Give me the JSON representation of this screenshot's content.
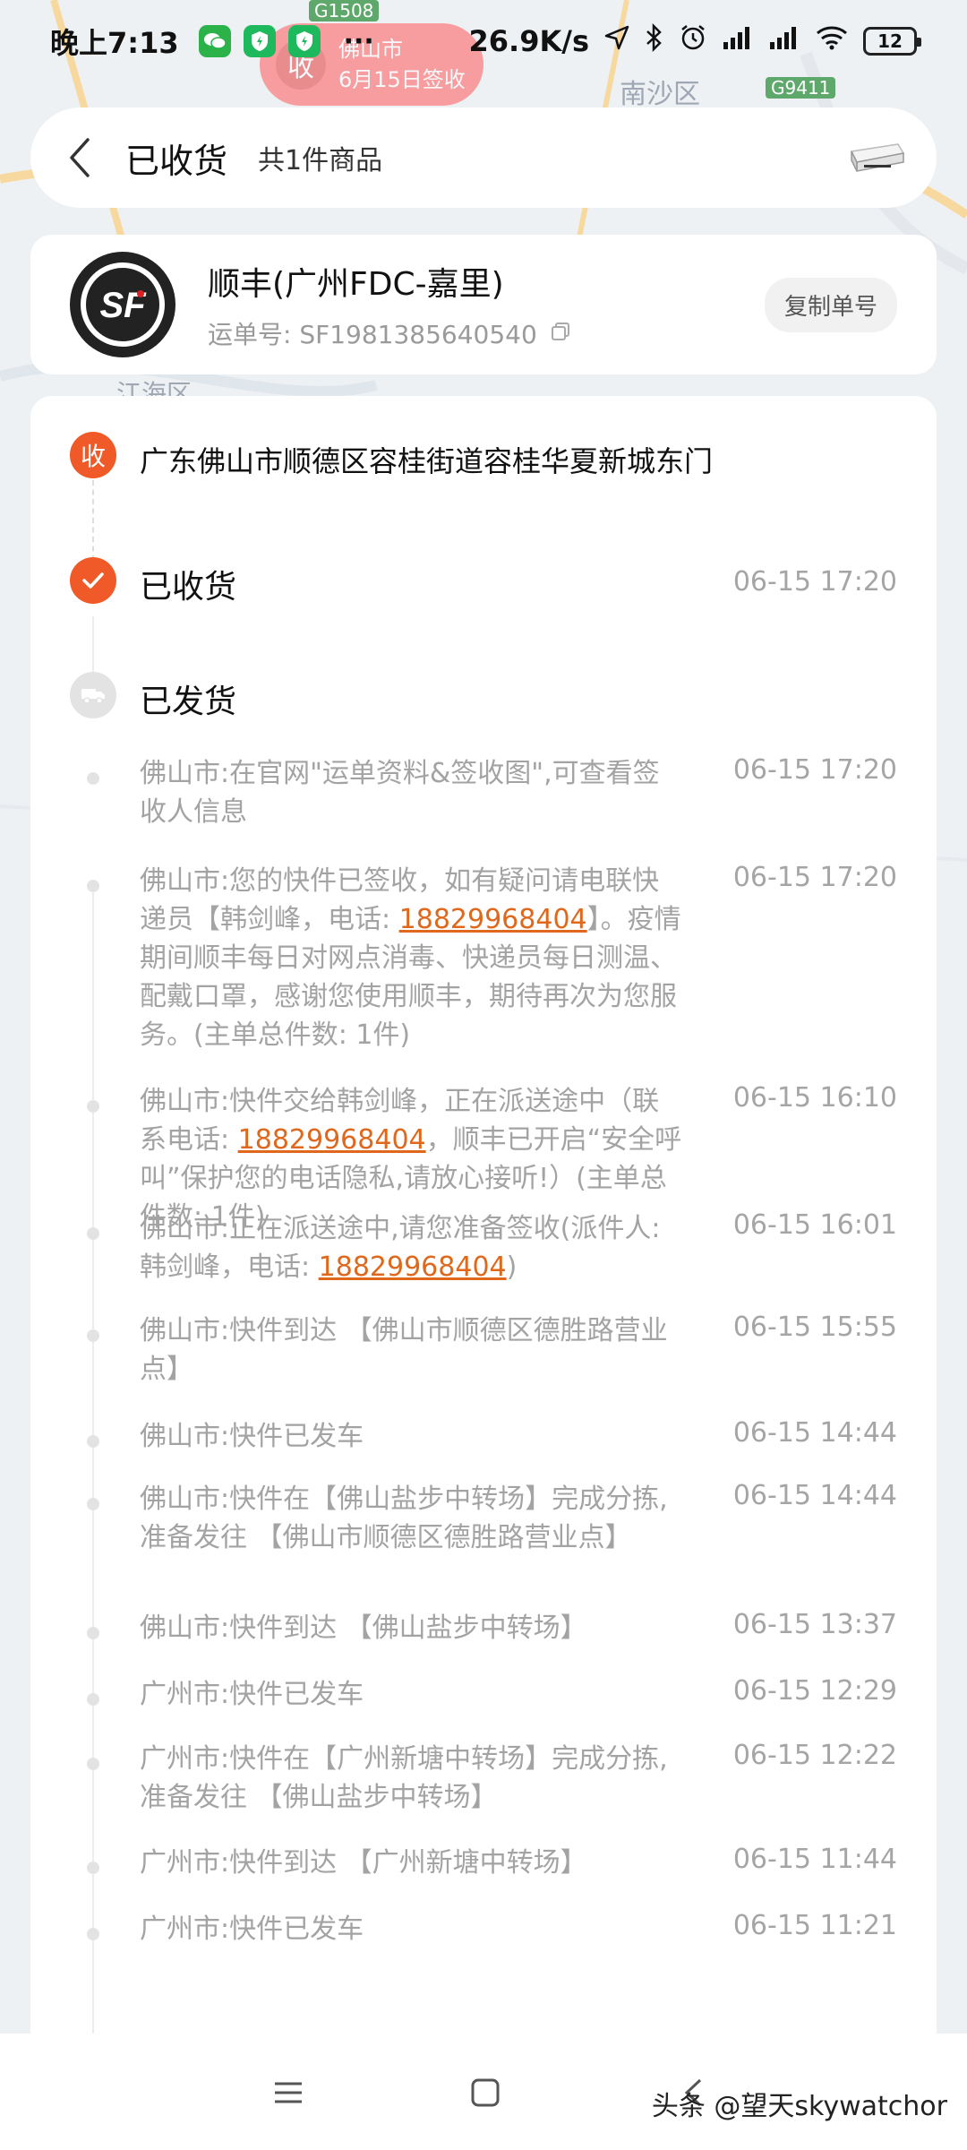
{
  "status_bar": {
    "time": "晚上7:13",
    "dots": "···",
    "speed": "26.9K/s",
    "battery": "12"
  },
  "map": {
    "marker_icon_text": "收",
    "marker_city": "佛山市",
    "marker_date": "6月15日签收",
    "labels": [
      "G1508",
      "南沙区",
      "G9411",
      "江海区"
    ]
  },
  "header": {
    "title": "已收货",
    "item_count": "共1件商品"
  },
  "courier": {
    "name": "顺丰(广州FDC-嘉里)",
    "waybill": "运单号: SF1981385640540",
    "copy_label": "复制单号"
  },
  "timeline": {
    "receiver_icon": "收",
    "address": "广东佛山市顺德区容桂街道容桂华夏新城东门",
    "received_status": "已收货",
    "received_time": "06-15 17:20",
    "shipped_status": "已发货",
    "events": [
      {
        "text_parts": [
          {
            "t": "佛山市:在官网\"运单资料&签收图\",可查看签收人信息"
          }
        ],
        "time": "06-15 17:20"
      },
      {
        "text_parts": [
          {
            "t": "佛山市:您的快件已签收，如有疑问请电联快递员【韩剑峰，电话: "
          },
          {
            "t": "18829968404",
            "link": true
          },
          {
            "t": "】。疫情期间顺丰每日对网点消毒、快递员每日测温、配戴口罩，感谢您使用顺丰，期待再次为您服务。(主单总件数: 1件)"
          }
        ],
        "time": "06-15 17:20"
      },
      {
        "text_parts": [
          {
            "t": "佛山市:快件交给韩剑峰，正在派送途中（联系电话: "
          },
          {
            "t": "18829968404",
            "link": true
          },
          {
            "t": "，顺丰已开启“安全呼叫”保护您的电话隐私,请放心接听!）(主单总件数: 1件)"
          }
        ],
        "time": "06-15 16:10"
      },
      {
        "text_parts": [
          {
            "t": "佛山市:正在派送途中,请您准备签收(派件人: 韩剑峰，电话: "
          },
          {
            "t": "18829968404",
            "link": true
          },
          {
            "t": ")"
          }
        ],
        "time": "06-15 16:01"
      },
      {
        "text_parts": [
          {
            "t": "佛山市:快件到达 【佛山市顺德区德胜路营业点】"
          }
        ],
        "time": "06-15 15:55"
      },
      {
        "text_parts": [
          {
            "t": "佛山市:快件已发车"
          }
        ],
        "time": "06-15 14:44"
      },
      {
        "text_parts": [
          {
            "t": "佛山市:快件在【佛山盐步中转场】完成分拣,准备发往 【佛山市顺德区德胜路营业点】"
          }
        ],
        "time": "06-15 14:44"
      },
      {
        "text_parts": [
          {
            "t": "佛山市:快件到达 【佛山盐步中转场】"
          }
        ],
        "time": "06-15 13:37"
      },
      {
        "text_parts": [
          {
            "t": "广州市:快件已发车"
          }
        ],
        "time": "06-15 12:29"
      },
      {
        "text_parts": [
          {
            "t": "广州市:快件在【广州新塘中转场】完成分拣,准备发往 【佛山盐步中转场】"
          }
        ],
        "time": "06-15 12:22"
      },
      {
        "text_parts": [
          {
            "t": "广州市:快件到达 【广州新塘中转场】"
          }
        ],
        "time": "06-15 11:44"
      },
      {
        "text_parts": [
          {
            "t": "广州市:快件已发车"
          }
        ],
        "time": "06-15 11:21"
      }
    ]
  },
  "watermark": "头条 @望天skywatchor",
  "colors": {
    "accent": "#f05a28",
    "link": "#e0681d",
    "marker": "#ff5a5a"
  }
}
